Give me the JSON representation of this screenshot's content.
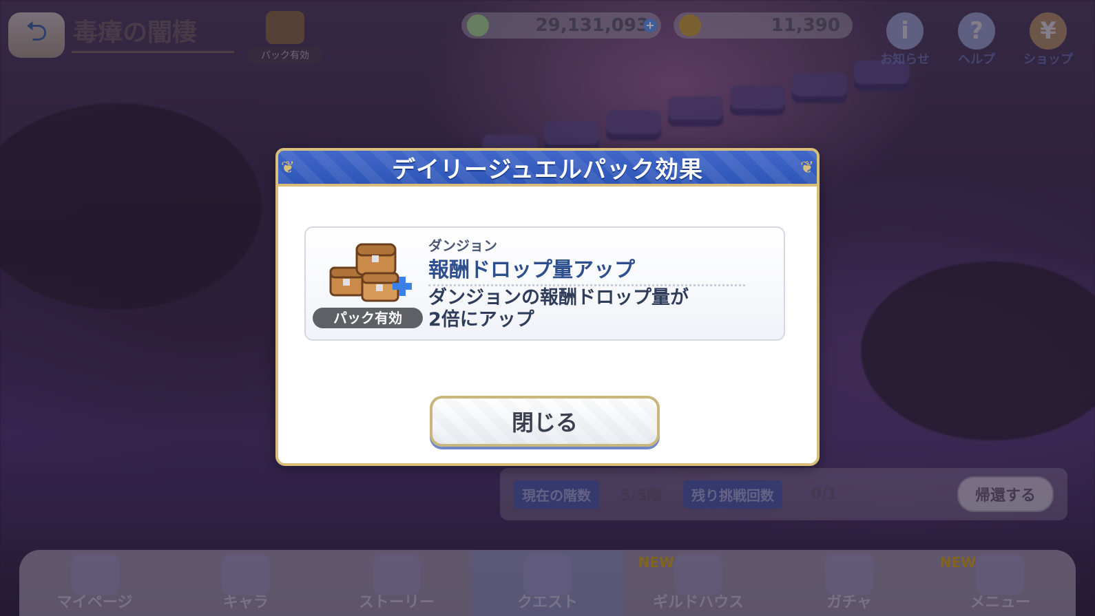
{
  "header": {
    "dungeon_title": "毒瘴の闇棲",
    "pack_mini_label": "パック有効",
    "mana": "29,131,093",
    "jewels": "11,390",
    "icons": [
      {
        "name": "info",
        "label": "お知らせ"
      },
      {
        "name": "help",
        "label": "ヘルプ"
      },
      {
        "name": "shop",
        "label": "ショップ"
      }
    ]
  },
  "status": {
    "current_floor_label": "現在の階数",
    "current_floor_value": "5/5階",
    "remaining_label": "残り挑戦回数",
    "remaining_value": "0/1",
    "return_button": "帰還する"
  },
  "bottom_nav": [
    {
      "label": "マイページ",
      "new": false,
      "active": false
    },
    {
      "label": "キャラ",
      "new": false,
      "active": false
    },
    {
      "label": "ストーリー",
      "new": false,
      "active": false
    },
    {
      "label": "クエスト",
      "new": false,
      "active": true
    },
    {
      "label": "ギルドハウス",
      "new": true,
      "active": false
    },
    {
      "label": "ガチャ",
      "new": false,
      "active": false
    },
    {
      "label": "メニュー",
      "new": true,
      "active": false
    }
  ],
  "new_badge": "NEW",
  "modal": {
    "title": "デイリージュエルパック効果",
    "badge": "パック有効",
    "category": "ダンジョン",
    "effect_name": "報酬ドロップ量アップ",
    "description": "ダンジョンの報酬ドロップ量が\n2倍にアップ",
    "close_button": "閉じる"
  },
  "colors": {
    "modal_header": "#3a61c4",
    "modal_border": "#d8be7a",
    "effect_name": "#2d4f8e",
    "pack_badge": "#5f6065"
  }
}
